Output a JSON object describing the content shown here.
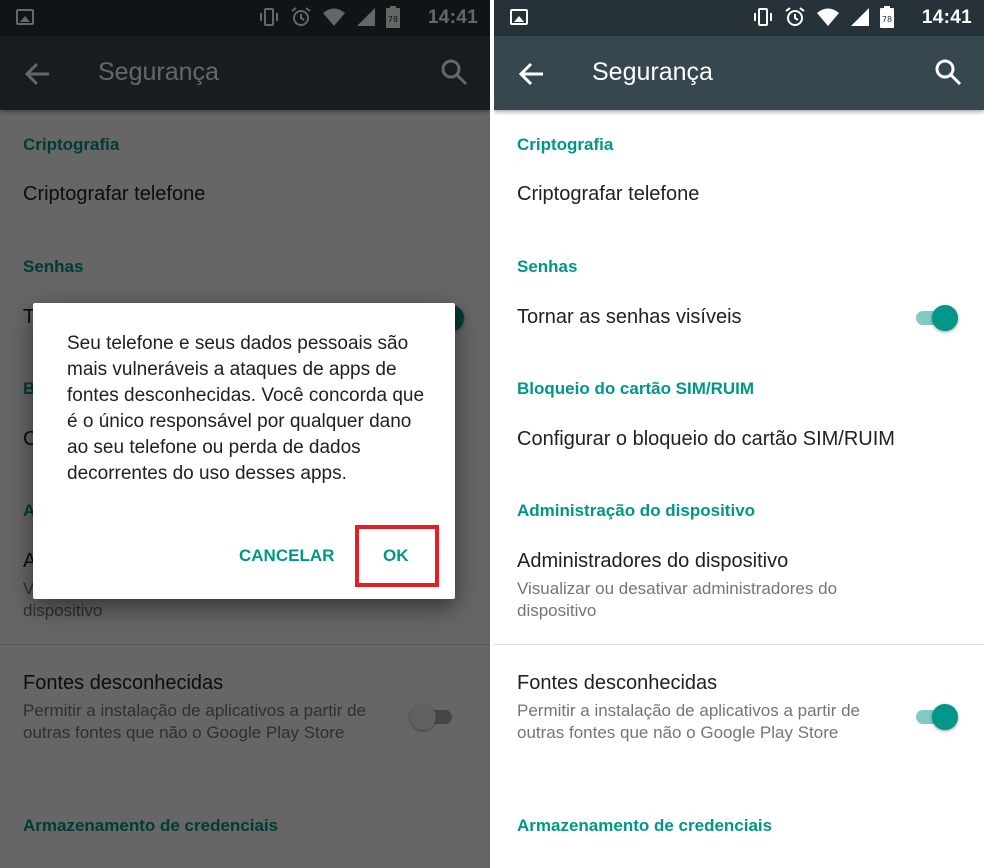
{
  "colors": {
    "accent": "#009688",
    "appbar": "#37474f",
    "statusbar": "#263238",
    "highlight": "#e31e24"
  },
  "status_bar": {
    "battery_level": "78",
    "time": "14:41",
    "icons": [
      "image-notification-icon",
      "vibrate-icon",
      "alarm-icon",
      "wifi-icon",
      "signal-icon",
      "battery-icon"
    ]
  },
  "app_bar": {
    "title": "Segurança",
    "back_icon": "arrow-back-icon",
    "search_icon": "search-icon"
  },
  "sections": {
    "encryption": {
      "header": "Criptografia",
      "item_title": "Criptografar telefone"
    },
    "passwords": {
      "header": "Senhas",
      "item_title": "Tornar as senhas visíveis",
      "toggle_on": true
    },
    "sim_lock": {
      "header": "Bloqueio do cartão SIM/RUIM",
      "item_title": "Configurar o bloqueio do cartão SIM/RUIM"
    },
    "device_admin": {
      "header": "Administração do dispositivo",
      "item_title": "Administradores do dispositivo",
      "item_summary": "Visualizar ou desativar administradores do dispositivo"
    },
    "unknown_sources": {
      "item_title": "Fontes desconhecidas",
      "item_summary": "Permitir a instalação de aplicativos a partir de outras fontes que não o Google Play Store",
      "toggle_on_left": false,
      "toggle_on_right": true
    },
    "credentials": {
      "header": "Armazenamento de credenciais"
    }
  },
  "dialog": {
    "message": "Seu telefone e seus dados pessoais são mais vulneráveis a ataques de apps de fontes desconhecidas. Você concorda que é o único responsável por qualquer dano ao seu telefone ou perda de dados decorrentes do uso desses apps.",
    "cancel_label": "CANCELAR",
    "ok_label": "OK"
  }
}
